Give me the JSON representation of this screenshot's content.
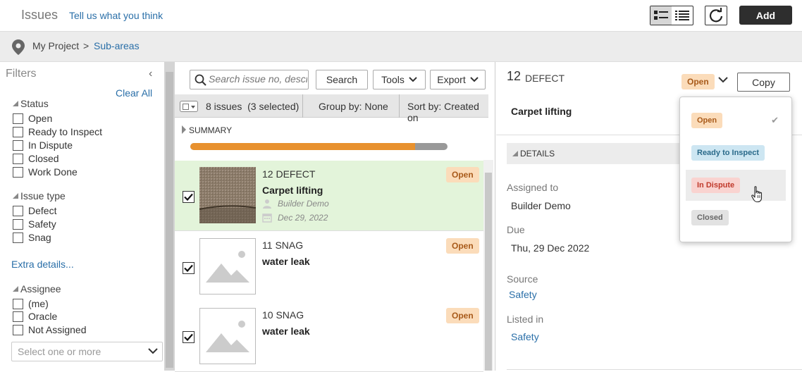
{
  "header": {
    "title": "Issues",
    "feedback_link": "Tell us what you think",
    "add_label": "Add",
    "icons": [
      "list-detail-icon",
      "list-compact-icon",
      "refresh-icon"
    ]
  },
  "breadcrumb": {
    "root": "My Project",
    "separator": ">",
    "current": "Sub-areas"
  },
  "filters": {
    "title": "Filters",
    "clear_all": "Clear All",
    "status": {
      "heading": "Status",
      "options": [
        "Open",
        "Ready to Inspect",
        "In Dispute",
        "Closed",
        "Work Done"
      ]
    },
    "issue_type": {
      "heading": "Issue type",
      "options": [
        "Defect",
        "Safety",
        "Snag"
      ]
    },
    "extra_details": "Extra details...",
    "assignee": {
      "heading": "Assignee",
      "options": [
        "(me)",
        "Oracle",
        "Not Assigned"
      ],
      "select_placeholder": "Select one or more"
    }
  },
  "toolbar": {
    "search_placeholder": "Search issue no, description",
    "search_label": "Search",
    "tools_label": "Tools",
    "export_label": "Export"
  },
  "list_header": {
    "count": "8 issues",
    "selected": "(3 selected)",
    "group_by": "Group by: None",
    "sort_by": "Sort by: Created on"
  },
  "summary": {
    "label": "SUMMARY",
    "progress_open_fraction": 0.875
  },
  "issues": [
    {
      "number": "12",
      "type": "DEFECT",
      "title": "Carpet lifting",
      "assignee": "Builder Demo",
      "date": "Dec 29, 2022",
      "status": "Open",
      "checked": true
    },
    {
      "number": "11",
      "type": "SNAG",
      "title": "water leak",
      "status": "Open",
      "checked": true
    },
    {
      "number": "10",
      "type": "SNAG",
      "title": "water leak",
      "status": "Open",
      "checked": true
    }
  ],
  "detail": {
    "number": "12",
    "type": "DEFECT",
    "status": "Open",
    "copy_label": "Copy",
    "title": "Carpet lifting",
    "details_heading": "DETAILS",
    "assigned_to_label": "Assigned to",
    "assigned_to": "Builder Demo",
    "due_label": "Due",
    "due": "Thu, 29 Dec 2022",
    "source_label": "Source",
    "source": "Safety",
    "listed_in_label": "Listed in",
    "listed_in": "Safety"
  },
  "status_menu": {
    "items": [
      {
        "label": "Open",
        "bg": "#fbdcba",
        "fg": "#a85a1a",
        "selected": true
      },
      {
        "label": "Ready to Inspect",
        "bg": "#cde6f2",
        "fg": "#2a6a8a"
      },
      {
        "label": "In Dispute",
        "bg": "#f9d3d0",
        "fg": "#c0392b",
        "hover": true
      },
      {
        "label": "Closed",
        "bg": "#e2e2e2",
        "fg": "#666666"
      }
    ],
    "check": "✔"
  },
  "colors": {
    "link": "#2a6fa8",
    "open_badge_bg": "#fbdcba",
    "progress_fill": "#e8912e",
    "selected_row": "#e3f4da"
  }
}
